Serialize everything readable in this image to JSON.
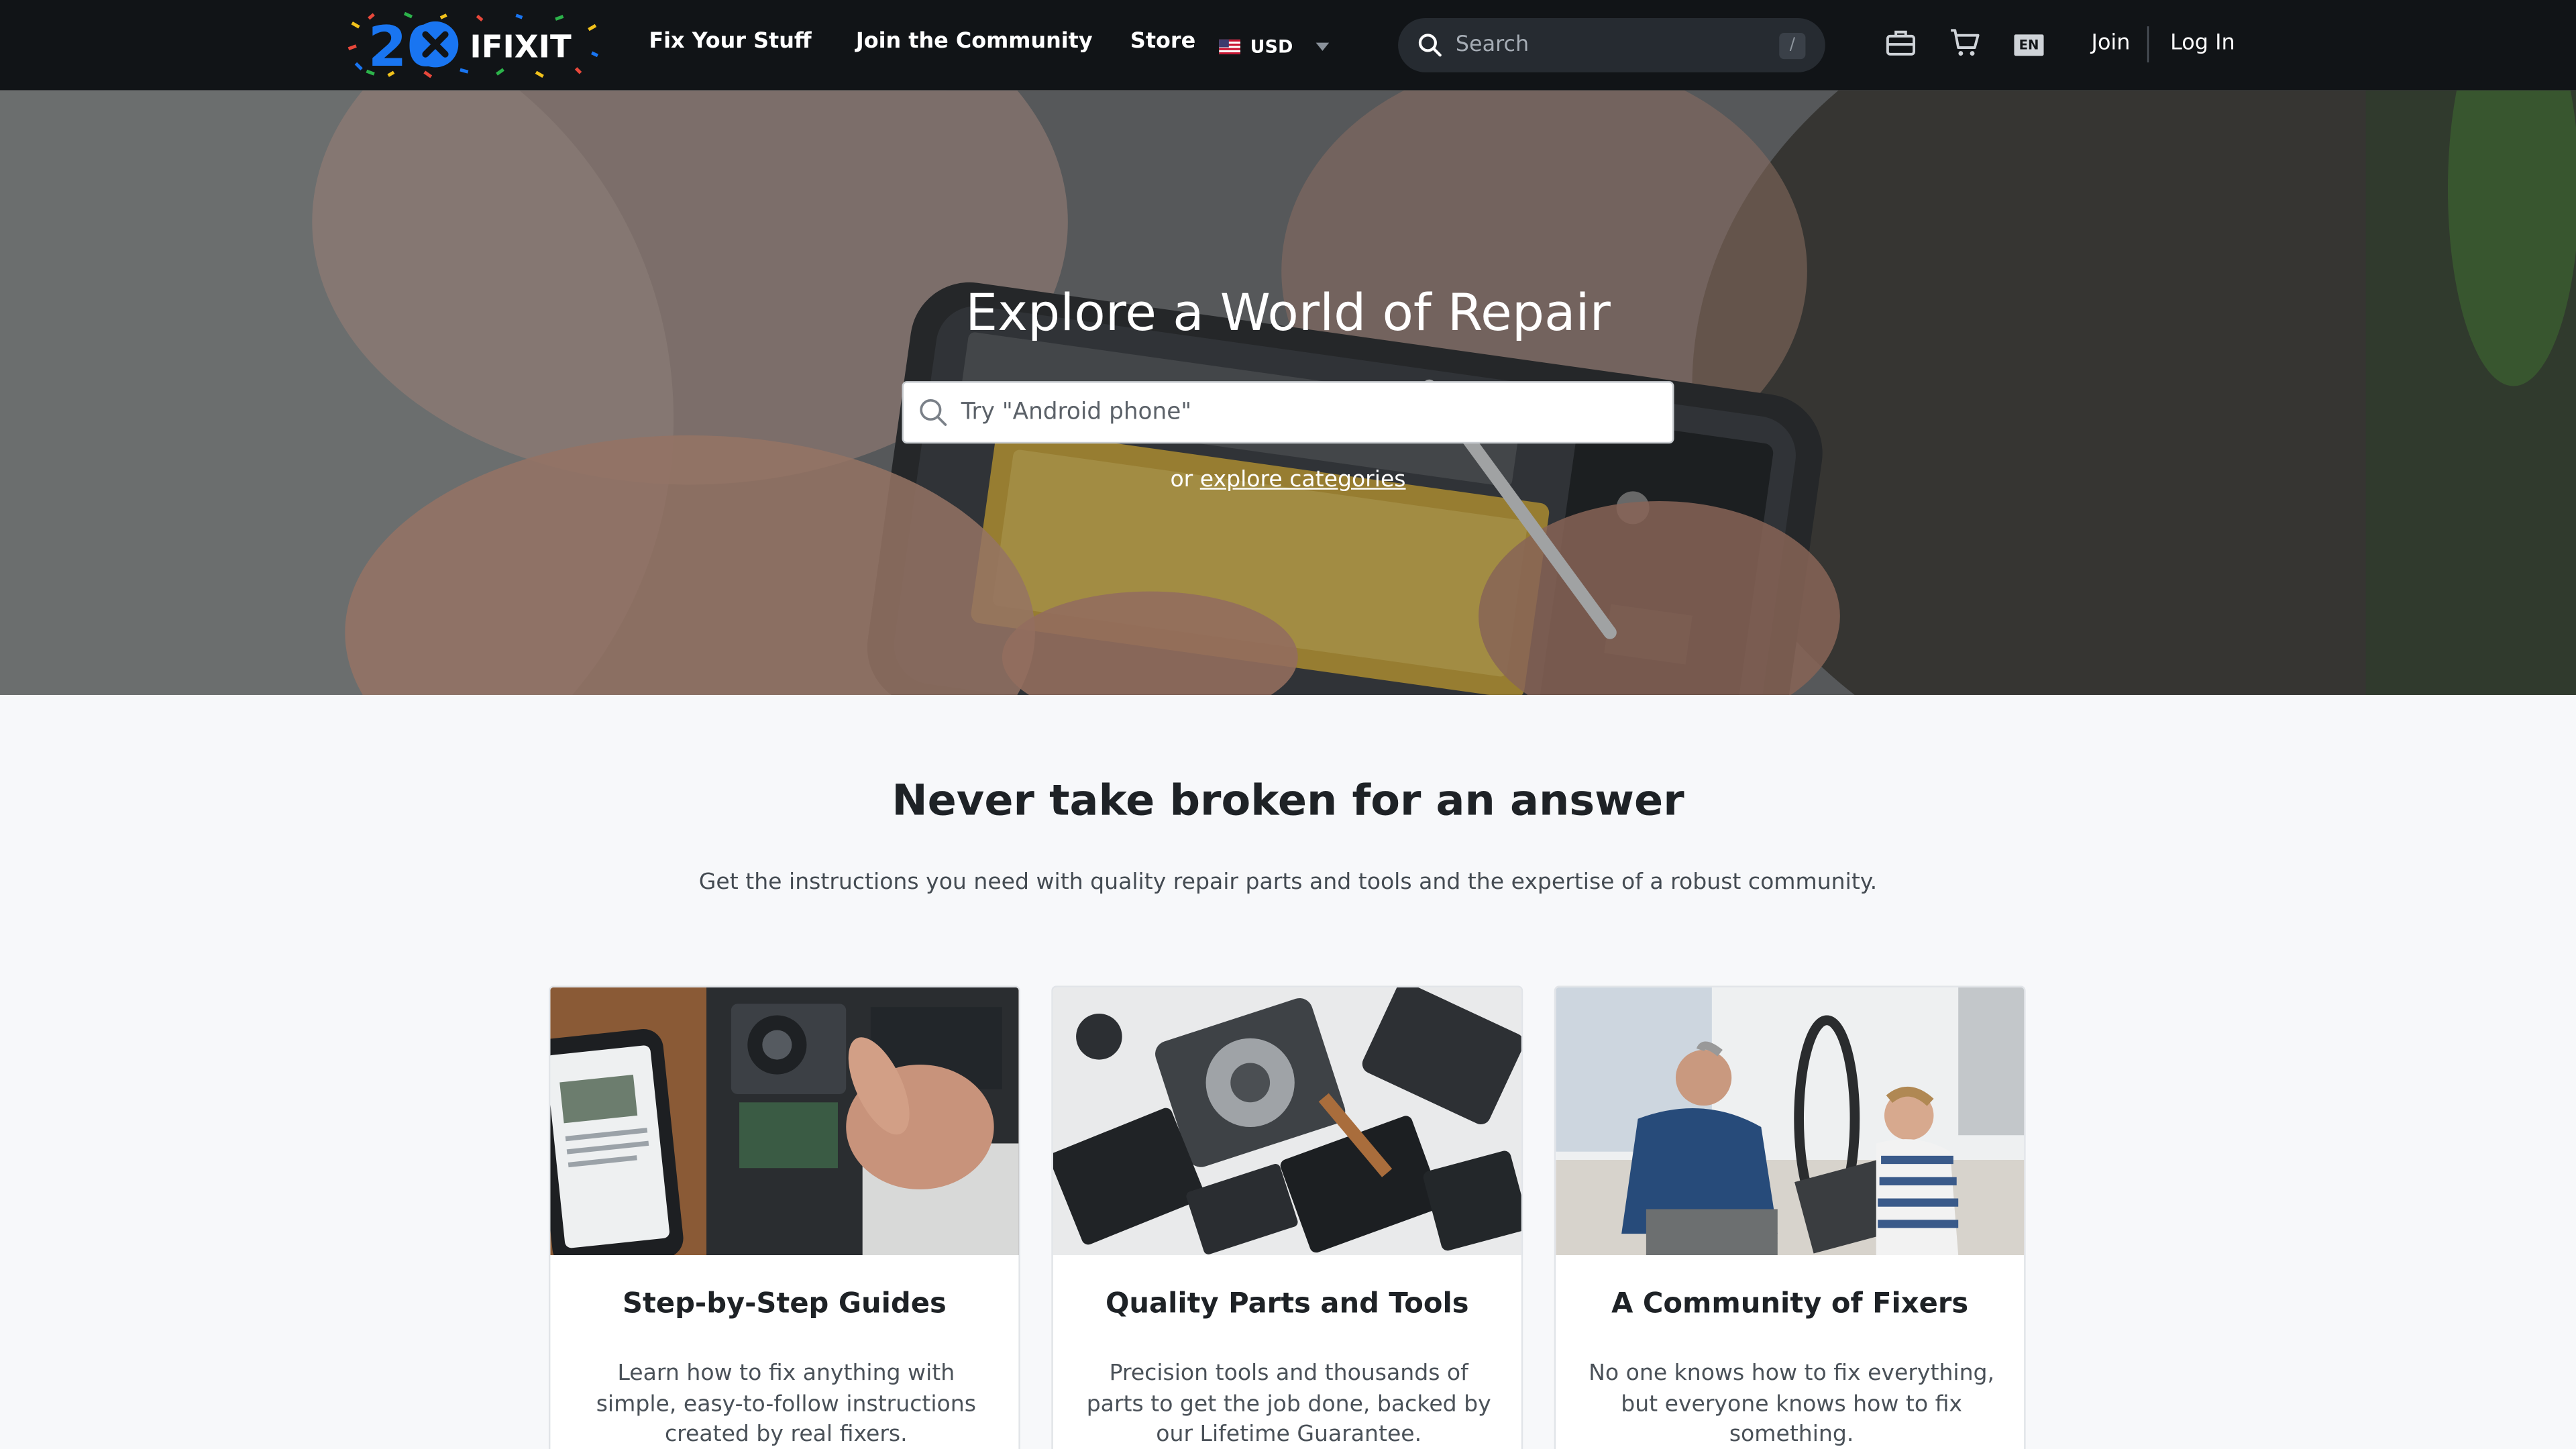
{
  "nav": {
    "logo_text": "IFIXIT",
    "logo_badge": "20",
    "links": [
      "Fix Your Stuff",
      "Join the Community",
      "Store"
    ],
    "currency": "USD",
    "search_placeholder": "Search",
    "search_shortcut": "/",
    "language": "EN",
    "join_label": "Join",
    "login_label": "Log In"
  },
  "hero": {
    "title": "Explore a World of Repair",
    "search_placeholder": "Try \"Android phone\"",
    "sub_prefix": "or ",
    "sub_link": "explore categories"
  },
  "main": {
    "title": "Never take broken for an answer",
    "subtitle": "Get the instructions you need with quality repair parts and tools and the expertise of a robust community."
  },
  "cards": [
    {
      "title": "Step-by-Step Guides",
      "text": "Learn how to fix anything with simple, easy-to-follow instructions created by real fixers."
    },
    {
      "title": "Quality Parts and Tools",
      "text": "Precision tools and thousands of parts to get the job done, backed by our Lifetime Guarantee."
    },
    {
      "title": "A Community of Fixers",
      "text": "No one knows how to fix everything, but everyone knows how to fix something."
    }
  ],
  "colors": {
    "nav_bg": "#111417",
    "logo_blue": "#1975f1",
    "page_bg": "#f7f8fa"
  }
}
